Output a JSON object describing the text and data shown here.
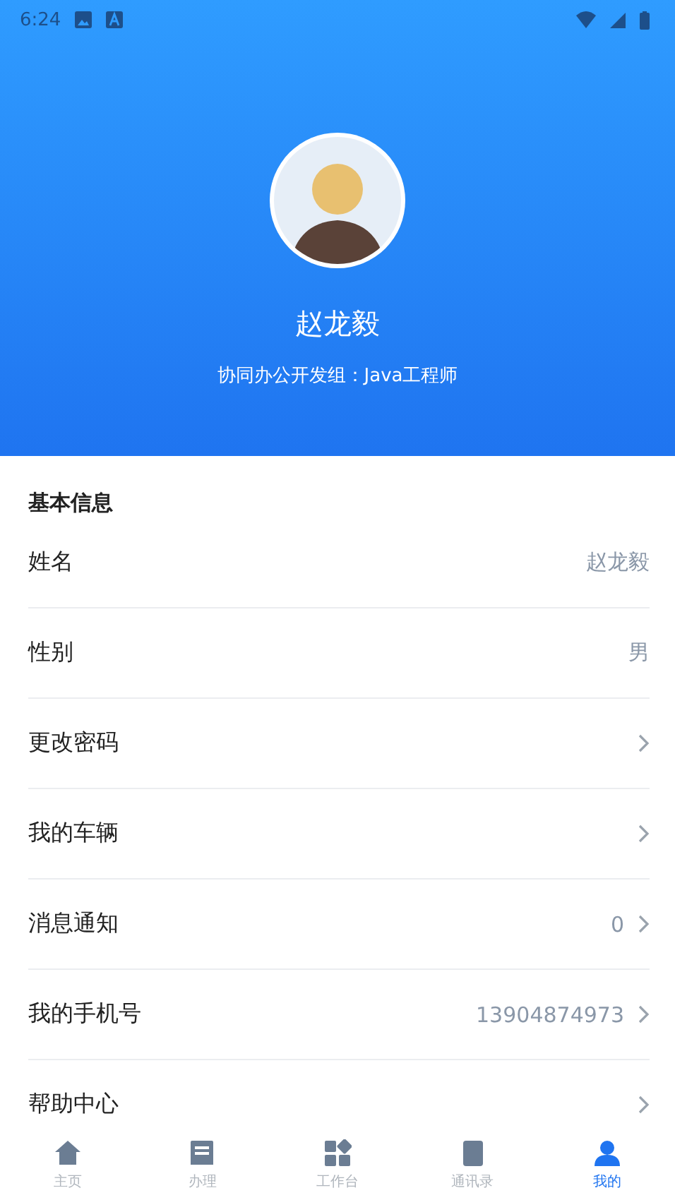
{
  "status_bar": {
    "time": "6:24"
  },
  "profile": {
    "name": "赵龙毅",
    "subtitle": "协同办公开发组：Java工程师"
  },
  "section": {
    "title": "基本信息"
  },
  "rows": [
    {
      "kind": "info",
      "label": "姓名",
      "value": "赵龙毅"
    },
    {
      "kind": "info",
      "label": "性别",
      "value": "男"
    },
    {
      "kind": "link",
      "label": "更改密码"
    },
    {
      "kind": "link",
      "label": "我的车辆"
    },
    {
      "kind": "link",
      "label": "消息通知",
      "value": "0"
    },
    {
      "kind": "link",
      "label": "我的手机号",
      "value": "13904874973"
    },
    {
      "kind": "link",
      "label": "帮助中心"
    }
  ],
  "nav": [
    {
      "label": "主页",
      "selected": false
    },
    {
      "label": "办理",
      "selected": false
    },
    {
      "label": "工作台",
      "selected": false
    },
    {
      "label": "通讯录",
      "selected": false
    },
    {
      "label": "我的",
      "selected": true
    }
  ]
}
